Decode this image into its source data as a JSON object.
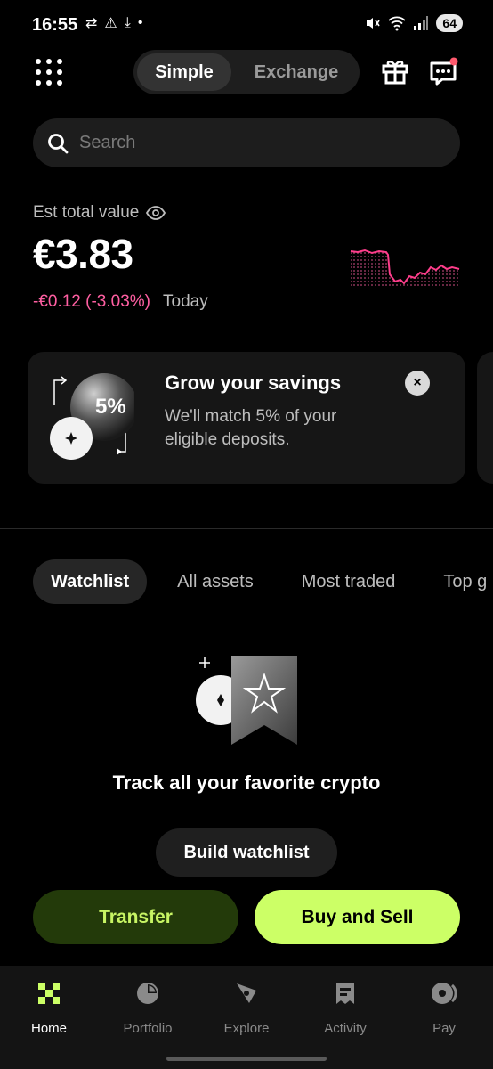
{
  "status_bar": {
    "time": "16:55",
    "battery": "64",
    "left_icons": [
      "swap-arrows-icon",
      "warning-icon",
      "download-icon",
      "dot-icon"
    ],
    "right_icons": [
      "mute-icon",
      "wifi-icon",
      "signal-icon"
    ]
  },
  "header": {
    "modes": [
      {
        "label": "Simple",
        "active": true
      },
      {
        "label": "Exchange",
        "active": false
      }
    ]
  },
  "search": {
    "placeholder": "Search"
  },
  "portfolio": {
    "label": "Est total value",
    "value": "€3.83",
    "change": "-€0.12 (-3.03%)",
    "period": "Today"
  },
  "promo": {
    "badge": "5%",
    "title": "Grow your savings",
    "body": "We'll match 5% of your eligible deposits.",
    "close": "×"
  },
  "tabs": [
    {
      "label": "Watchlist",
      "active": true
    },
    {
      "label": "All assets",
      "active": false
    },
    {
      "label": "Most traded",
      "active": false
    },
    {
      "label": "Top g",
      "active": false
    }
  ],
  "watchlist_empty": {
    "message": "Track all your favorite crypto",
    "button": "Build watchlist"
  },
  "actions": {
    "transfer": "Transfer",
    "buy_sell": "Buy and Sell"
  },
  "bottom_nav": [
    {
      "label": "Home",
      "icon": "home-x-icon",
      "active": true
    },
    {
      "label": "Portfolio",
      "icon": "pie-chart-icon",
      "active": false
    },
    {
      "label": "Explore",
      "icon": "compass-icon",
      "active": false
    },
    {
      "label": "Activity",
      "icon": "receipt-icon",
      "active": false
    },
    {
      "label": "Pay",
      "icon": "pay-icon",
      "active": false
    }
  ],
  "colors": {
    "accent": "#ccff66",
    "negative": "#ff5fa2",
    "background": "#000000"
  }
}
